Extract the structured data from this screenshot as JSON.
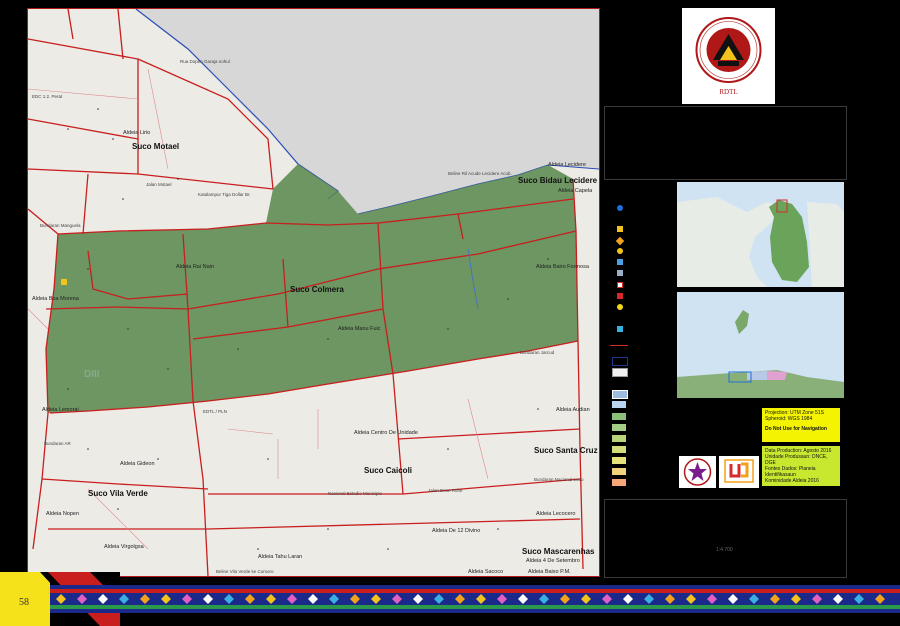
{
  "page": {
    "number": "58"
  },
  "colors": {
    "suco_fill": "#5b8a50",
    "boundary": "#c81e1e",
    "sea": "#d7d7d7",
    "coast": "#2a4cb8",
    "map_bg": "#ecebe6",
    "panel_bg": "#000000",
    "note_box": "#f4f400",
    "band_yellow": "#f6e21b"
  },
  "map": {
    "watermark": "DIII",
    "sucos": [
      {
        "name": "Suco Motael"
      },
      {
        "name": "Suco Bidau Lecidere"
      },
      {
        "name": "Suco Colmera"
      },
      {
        "name": "Suco Santa Cruz"
      },
      {
        "name": "Suco Caicoli"
      },
      {
        "name": "Suco Vila Verde"
      },
      {
        "name": "Suco Mascarenhas"
      }
    ],
    "aldeias": [
      {
        "name": "Aldeia Lirio"
      },
      {
        "name": "Aldeia Lecidere"
      },
      {
        "name": "Aldeia Capela"
      },
      {
        "name": "Aldeia Rai Nain"
      },
      {
        "name": "Aldeia Bairo Formosa"
      },
      {
        "name": "Aldeia Boa Morena"
      },
      {
        "name": "Aldeia Manu Fuic"
      },
      {
        "name": "Aldeia Lemorai"
      },
      {
        "name": "Aldeia Audian"
      },
      {
        "name": "Aldeia Centro De Unidade"
      },
      {
        "name": "Aldeia Gideon"
      },
      {
        "name": "Aldeia Nopen"
      },
      {
        "name": "Aldeia Virgolgsa"
      },
      {
        "name": "Aldeia Tahu Laran"
      },
      {
        "name": "Aldeia De 12 Divino"
      },
      {
        "name": "Aldeia 4 De Setembro"
      },
      {
        "name": "Aldeia Baixo P.M."
      },
      {
        "name": "Aldeia Sacoco"
      },
      {
        "name": "Aldeia Lecocero"
      }
    ],
    "streets": [
      {
        "name": "Rua Dopen Garaja nohul"
      },
      {
        "name": "EDC 1.2. Perat"
      },
      {
        "name": "Jalan Motael"
      },
      {
        "name": "Katalampur Tiga Dollar Br."
      },
      {
        "name": "Bundaran Manguela"
      },
      {
        "name": "Beline Ril Acude Lecidere Acub."
      },
      {
        "name": "Bundaran Jarcud"
      },
      {
        "name": "EDTL / PLN"
      },
      {
        "name": "Bundaran Nacional Lodo"
      },
      {
        "name": "Jalan Dose Rohe"
      },
      {
        "name": "Bundaran AR"
      },
      {
        "name": "Nacional Estadio Municipio"
      },
      {
        "name": "Beline Vila Verde ke Comoro"
      }
    ]
  },
  "legend": {
    "symbols": [
      {
        "icon": "dot-icon",
        "color": "#1f6fd6"
      },
      {
        "icon": "square-icon",
        "color": "#f2c41b"
      },
      {
        "icon": "diamond-icon",
        "color": "#f2a21b"
      },
      {
        "icon": "gear-icon",
        "color": "#f2c41b"
      },
      {
        "icon": "flag-icon",
        "color": "#4aa0e0"
      },
      {
        "icon": "church-icon",
        "color": "#9bb0c8"
      },
      {
        "icon": "cross-icon",
        "color": "#d42b2b"
      },
      {
        "icon": "sun-icon",
        "color": "#f2d81b"
      },
      {
        "icon": "info-icon",
        "color": "#3ab0e0"
      }
    ],
    "swatches": [
      {
        "color": "#1b3a8a"
      },
      {
        "color": "#f0f0f0"
      },
      {
        "color": "#9bbbe0"
      },
      {
        "color": "#b9d4ee"
      },
      {
        "color": "#8bbf7a"
      },
      {
        "color": "#a3cc84"
      },
      {
        "color": "#b9d37a"
      },
      {
        "color": "#d3dc7a"
      },
      {
        "color": "#e7e27a"
      },
      {
        "color": "#f2d27a"
      },
      {
        "color": "#f6c07a"
      },
      {
        "color": "#f6a77a"
      },
      {
        "color": "#f08a7a"
      }
    ]
  },
  "logo": {
    "text": "REPUBLICA DEMOCRATICA DE TIMOR-LESTE",
    "abbr": "RDTL"
  },
  "projection": {
    "line1": "Projection: UTM Zone 51S",
    "line2": "Spheroid: WGS 1984",
    "warning": "Do Not Use for Navigation"
  },
  "source": {
    "line1": "Data Production: Agosto 2016",
    "line2": "Unidade Produsaun: DNCE, DGE",
    "line3": "Fontes Dados: Planeia Identifikasaun",
    "line4": "Kominidade Aldeia 2016"
  },
  "scale": {
    "text": "1:4.700"
  }
}
